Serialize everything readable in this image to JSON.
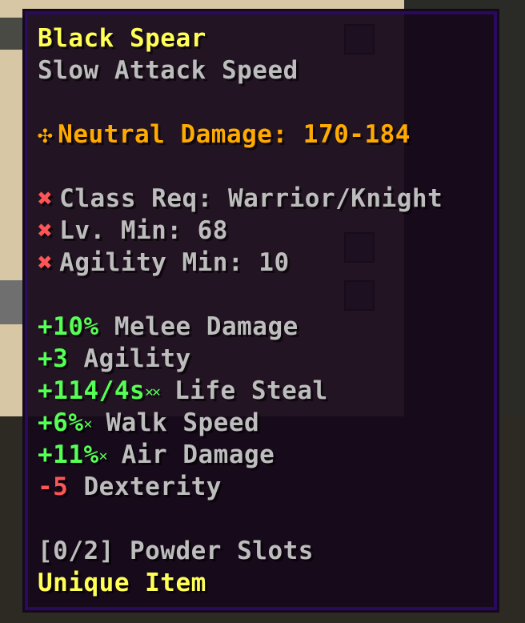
{
  "item": {
    "name": "Black Spear",
    "attack_speed": "Slow Attack Speed",
    "damage_icon": "neutral-damage-icon",
    "damage": "Neutral Damage: 170-184",
    "requirements": [
      {
        "icon": "requirement-unmet-icon",
        "glyph": "✖",
        "text": "Class Req: Warrior/Knight"
      },
      {
        "icon": "requirement-unmet-icon",
        "glyph": "✖",
        "text": "Lv. Min: 68"
      },
      {
        "icon": "requirement-unmet-icon",
        "glyph": "✖",
        "text": "Agility Min: 10"
      }
    ],
    "identifications": [
      {
        "value": "+10%",
        "stars": "",
        "label": "Melee Damage"
      },
      {
        "value": "+3",
        "stars": "",
        "label": "Agility"
      },
      {
        "value": "+114/4s",
        "stars": "✕✕",
        "label": "Life Steal"
      },
      {
        "value": "+6%",
        "stars": "✕",
        "label": "Walk Speed"
      },
      {
        "value": "+11%",
        "stars": "✕",
        "label": "Air Damage"
      }
    ],
    "negative_identifications": [
      {
        "value": "-5",
        "label": "Dexterity"
      }
    ],
    "powder_slots": "[0/2] Powder Slots",
    "rarity": "Unique Item"
  },
  "colors": {
    "name": "#ffff55",
    "damage": "#ffaa00",
    "requirement_unmet": "#ff5555",
    "positive": "#55ff55",
    "negative": "#ff5555",
    "muted": "#bdbdbd",
    "tooltip_background": "#16081a",
    "tooltip_border": "#2a0a5c"
  }
}
